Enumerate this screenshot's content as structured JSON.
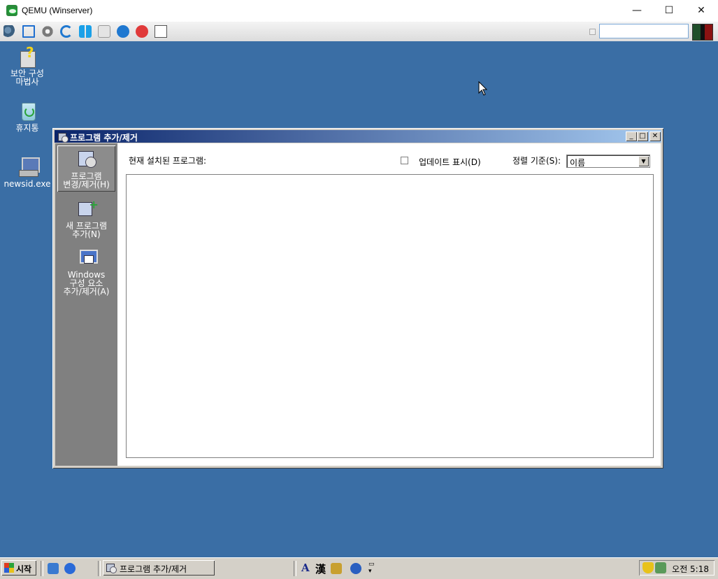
{
  "host": {
    "title": "QEMU (Winserver)",
    "min_glyph": "—",
    "max_glyph": "☐",
    "close_glyph": "✕",
    "toolbar_icons": [
      "settings-bubbles-icon",
      "fullscreen-icon",
      "gear-icon",
      "refresh-icon",
      "windows-logo-icon",
      "drive-icon",
      "info-icon",
      "stop-icon",
      "save-screenshot-icon"
    ],
    "search_value": ""
  },
  "desktop": {
    "icons": [
      {
        "label": "보안 구성\n마법사",
        "icon": "security-wizard-icon"
      },
      {
        "label": "휴지통",
        "icon": "recycle-bin-icon"
      },
      {
        "label": "newsid.exe",
        "icon": "computer-exe-icon"
      }
    ]
  },
  "dialog": {
    "title": "프로그램 추가/제거",
    "sidebar": [
      {
        "label": "프로그램\n변경/제거(H)",
        "selected": true,
        "icon": "change-remove-programs-icon"
      },
      {
        "label": "새 프로그램\n추가(N)",
        "selected": false,
        "icon": "add-new-program-icon"
      },
      {
        "label": "Windows\n구성 요소\n추가/제거(A)",
        "selected": false,
        "icon": "windows-components-icon"
      }
    ],
    "installed_label": "현재 설치된 프로그램:",
    "show_updates_label": "업데이트 표시(D)",
    "show_updates_checked": false,
    "sort_label": "정렬 기준(S):",
    "sort_value": "이름"
  },
  "taskbar": {
    "start_label": "시작",
    "task_label": "프로그램 추가/제거",
    "lang_a": "A",
    "lang_han": "漢",
    "clock": "오전 5:18"
  }
}
